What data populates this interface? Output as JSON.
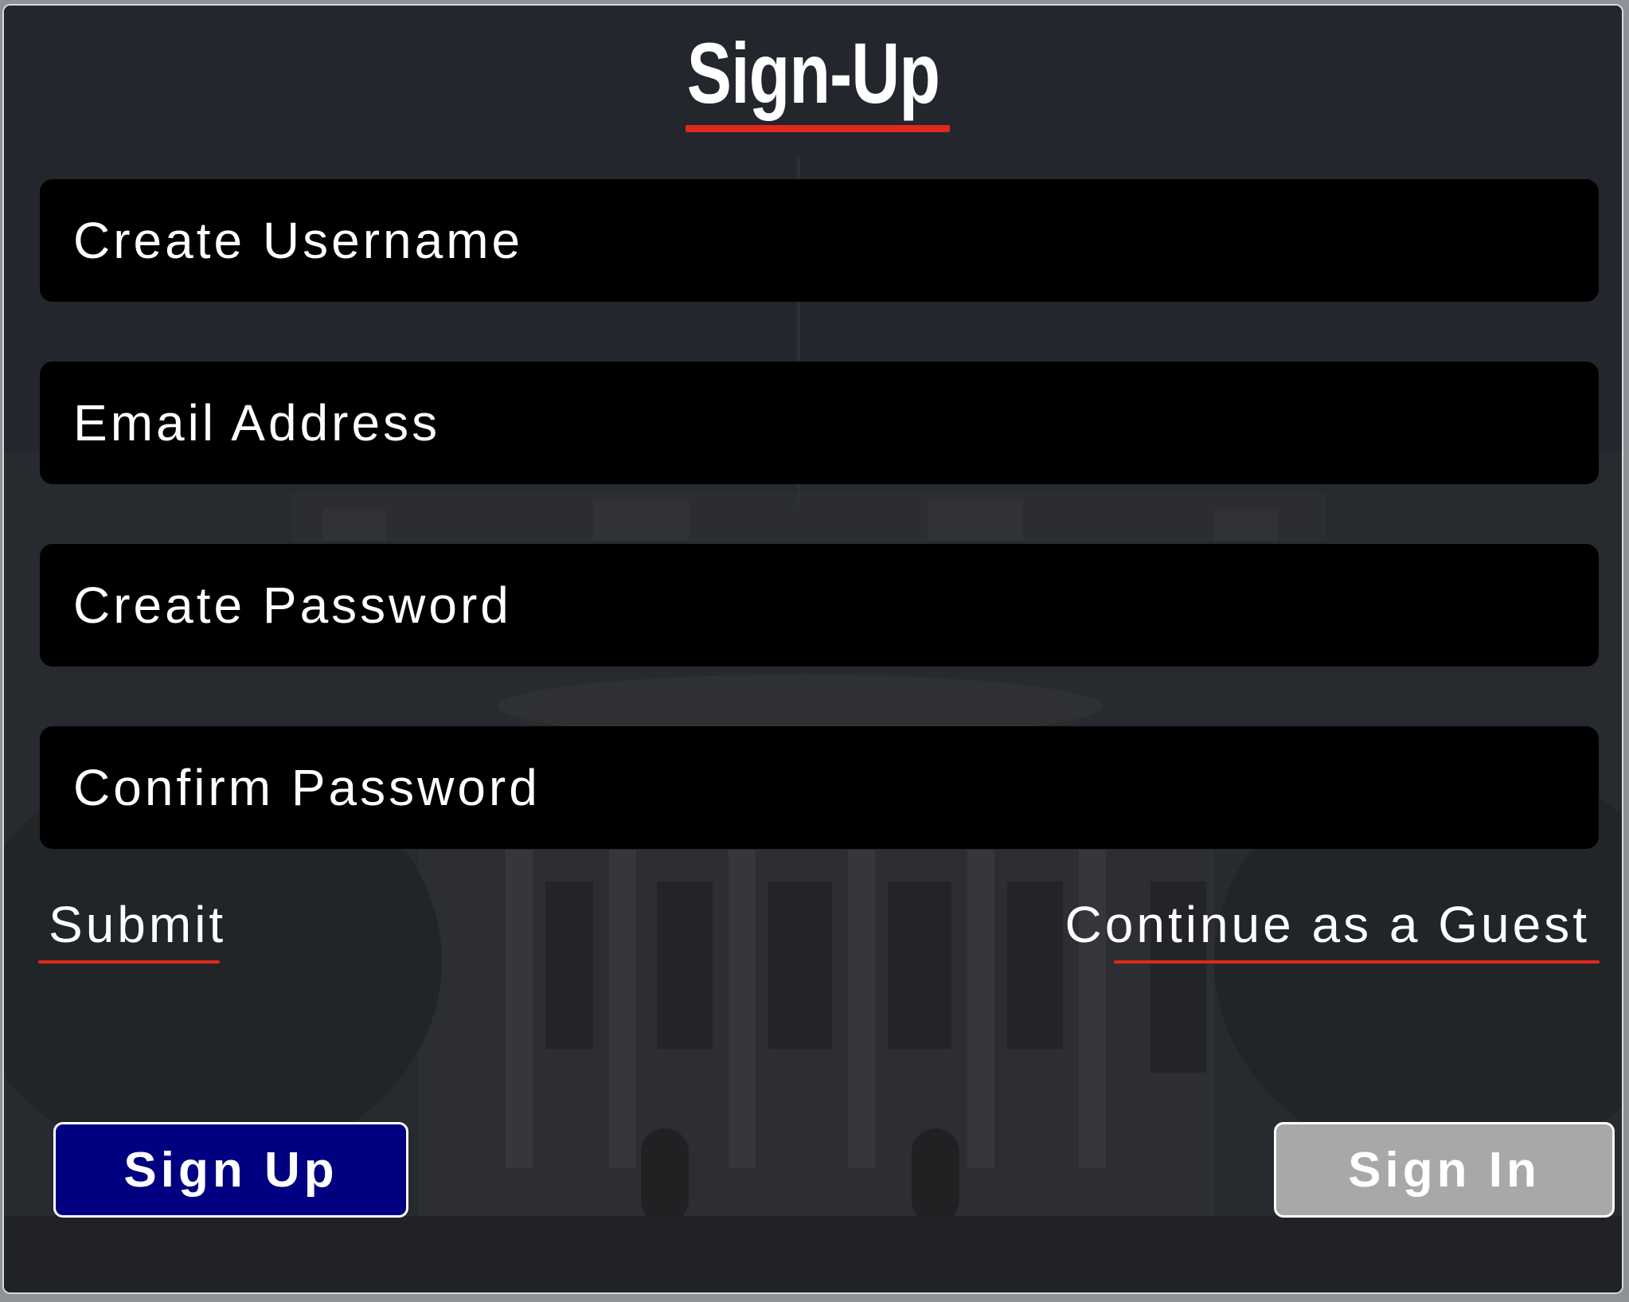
{
  "form": {
    "title": "Sign-Up",
    "fields": [
      {
        "placeholder": "Create Username",
        "value": ""
      },
      {
        "placeholder": "Email Address",
        "value": ""
      },
      {
        "placeholder": "Create Password",
        "value": ""
      },
      {
        "placeholder": "Confirm Password",
        "value": ""
      }
    ],
    "submit_label": "Submit",
    "guest_label": "Continue as a Guest"
  },
  "tabs": {
    "sign_up_label": "Sign Up",
    "sign_in_label": "Sign In"
  },
  "colors": {
    "accent": "#e0281d",
    "sign_up_button": "#000080",
    "sign_in_button": "#a8a8a8",
    "field_background": "#000000",
    "panel_background": "#23272d"
  }
}
